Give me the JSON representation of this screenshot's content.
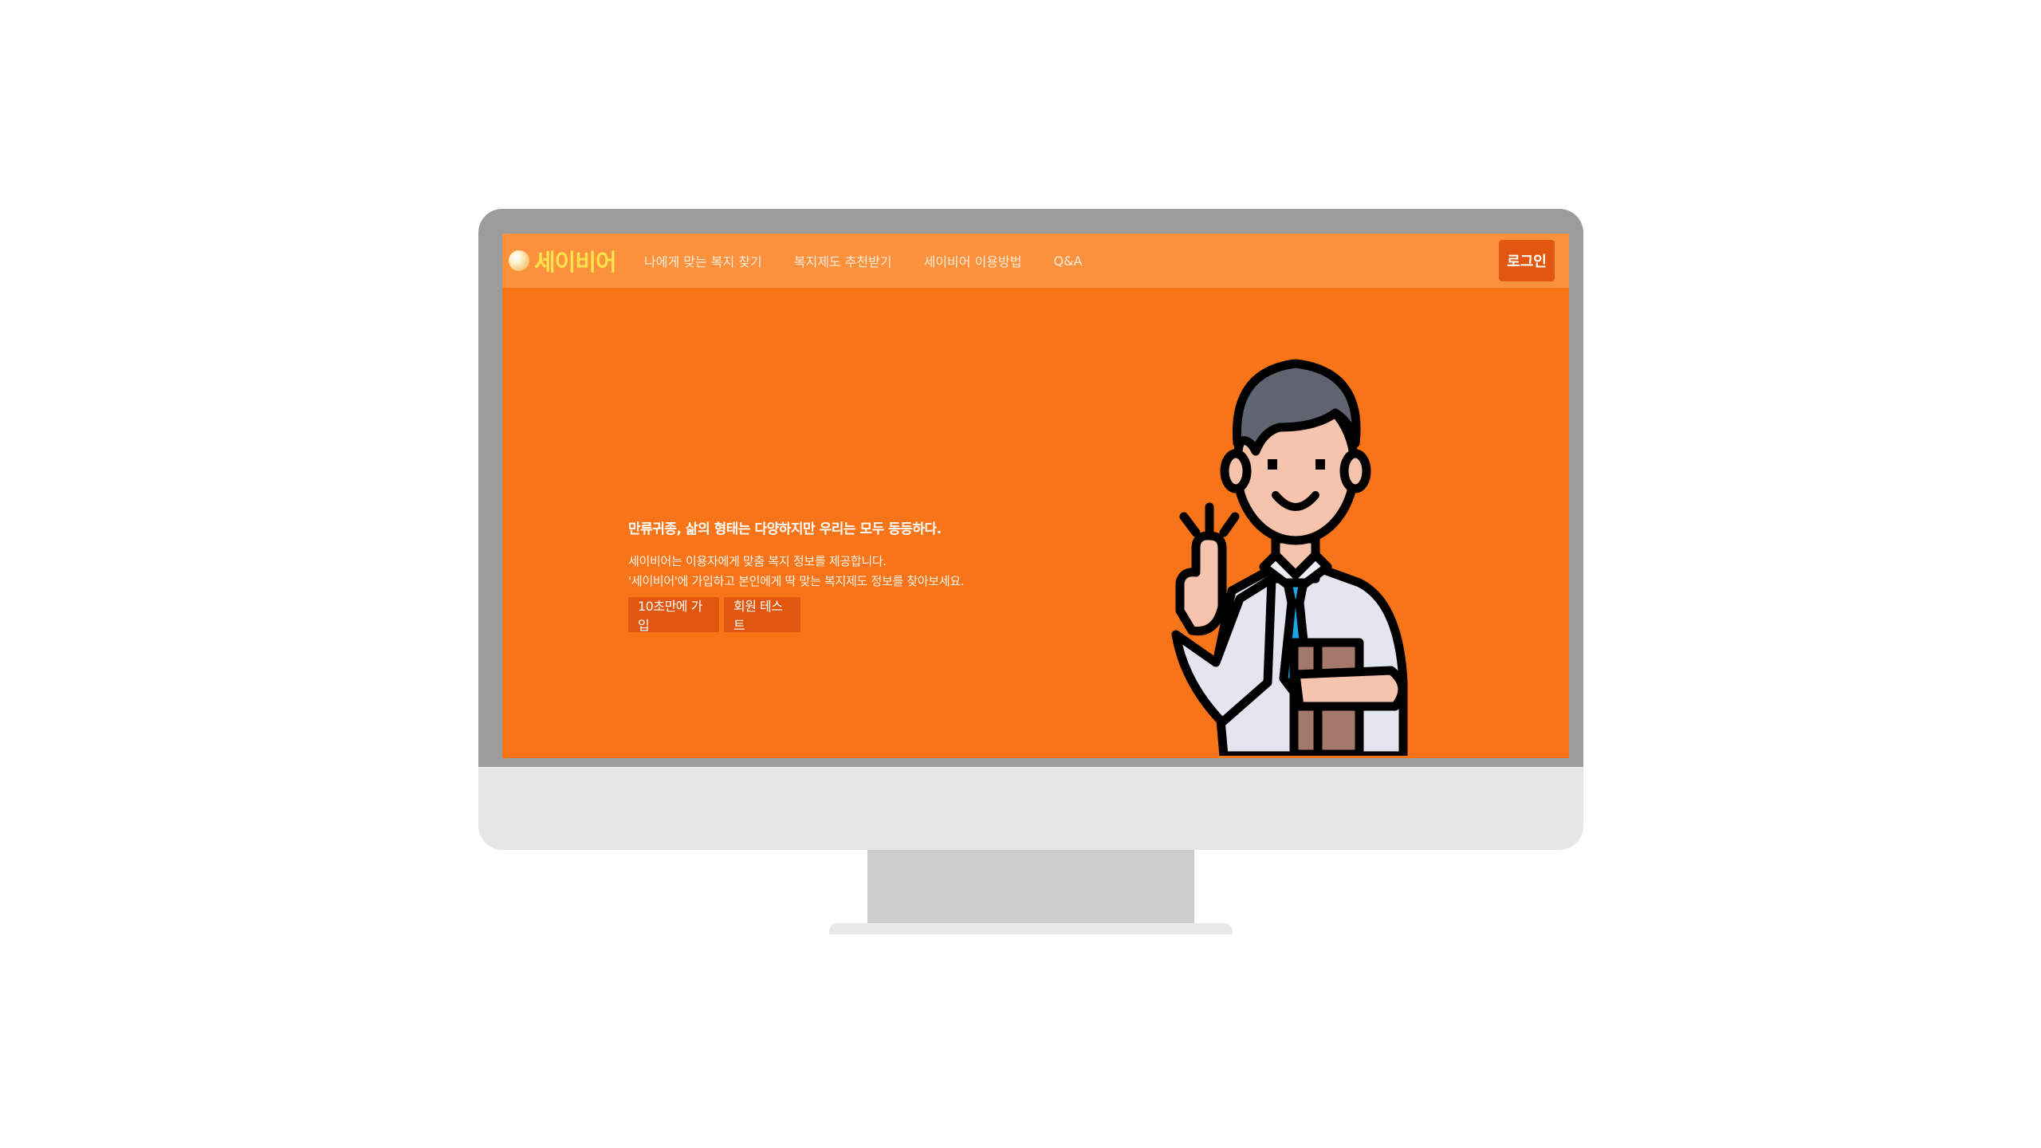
{
  "site": {
    "logo_text": "세이비어",
    "nav": [
      "나에게 맞는 복지 찾기",
      "복지제도 추천받기",
      "세이비어 이용방법",
      "Q&A"
    ],
    "login_label": "로그인"
  },
  "hero": {
    "headline": "만류귀종, 삶의 형태는 다양하지만 우리는 모두 동등하다.",
    "desc_line1": "세이비어는 이용자에게 맞춤 복지 정보를 제공합니다.",
    "desc_line2": "'세이비어'에 가입하고 본인에게 딱 맞는 복지제도 정보를 찾아보세요.",
    "primary_cta": "10초만에 가입",
    "secondary_cta": "회원 테스트"
  },
  "colors": {
    "header_bg": "#fb913d",
    "hero_bg": "#f77418",
    "button_bg": "#e2570f",
    "logo_text": "#ffe34a"
  },
  "icons": [
    "logo-orb-icon",
    "businessman-illustration"
  ]
}
